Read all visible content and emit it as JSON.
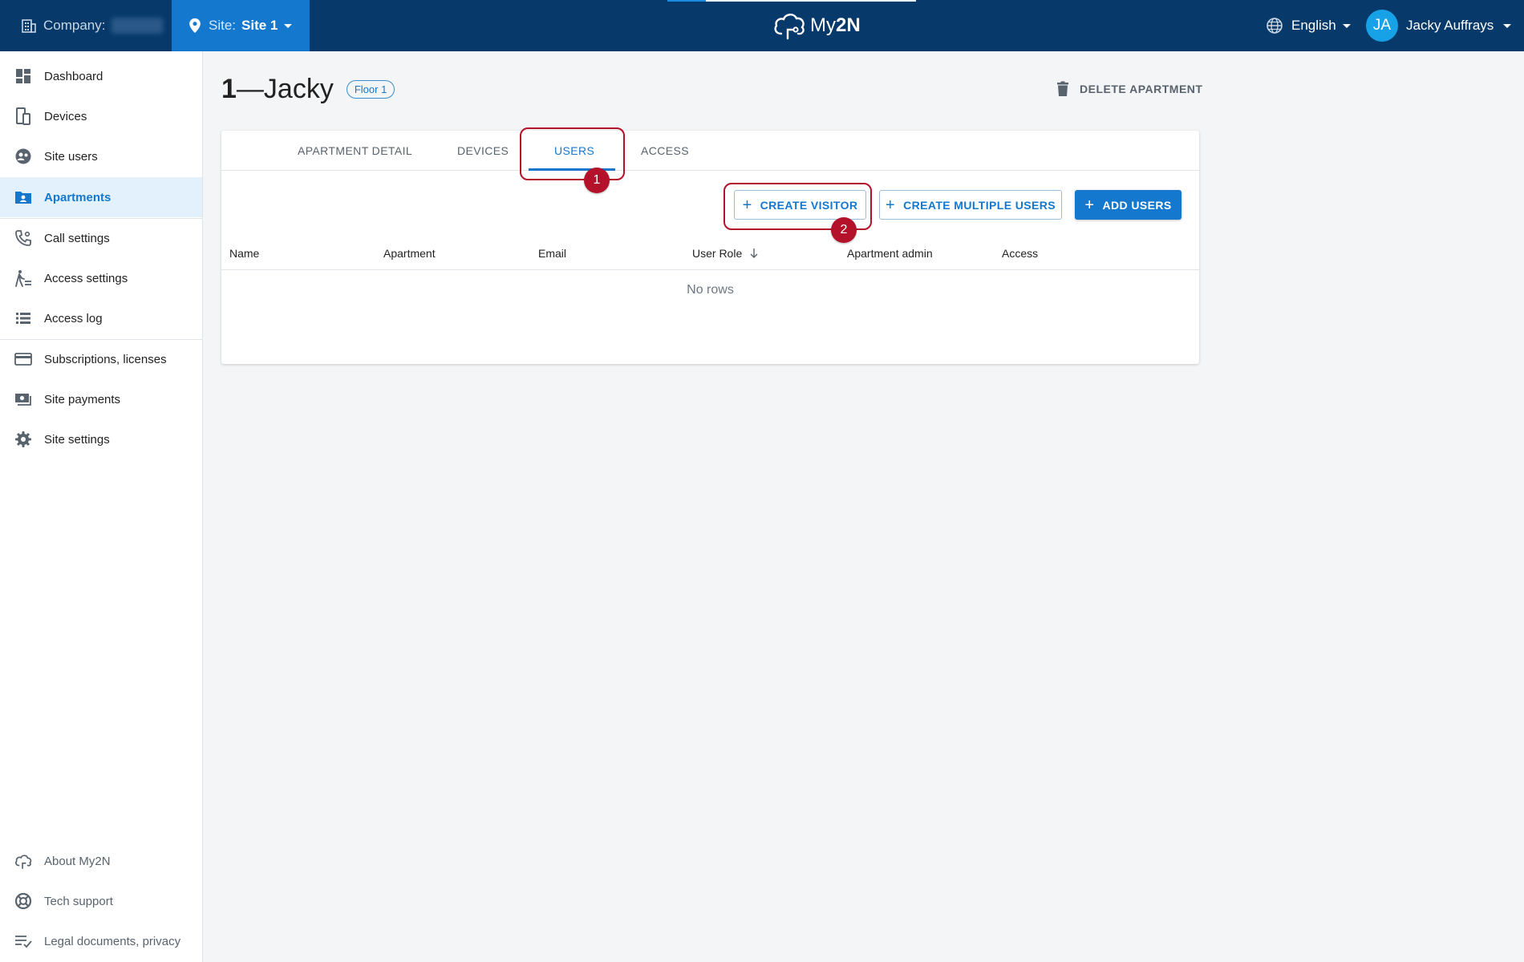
{
  "topbar": {
    "company_label": "Company:",
    "site_label": "Site:",
    "site_value": "Site 1",
    "logo_text_light": "My",
    "logo_text_bold": "2N",
    "language": "English",
    "user_initials": "JA",
    "user_name": "Jacky Auffrays"
  },
  "sidebar": {
    "items": [
      {
        "label": "Dashboard",
        "icon": "dashboard-icon"
      },
      {
        "label": "Devices",
        "icon": "devices-icon"
      },
      {
        "label": "Site users",
        "icon": "site-users-icon"
      },
      {
        "label": "Apartments",
        "icon": "apartments-icon",
        "active": true
      },
      {
        "label": "Call settings",
        "icon": "call-settings-icon"
      },
      {
        "label": "Access settings",
        "icon": "access-settings-icon"
      },
      {
        "label": "Access log",
        "icon": "access-log-icon"
      },
      {
        "label": "Subscriptions, licenses",
        "icon": "credit-card-icon"
      },
      {
        "label": "Site payments",
        "icon": "payments-icon"
      },
      {
        "label": "Site settings",
        "icon": "gear-icon"
      }
    ],
    "footer": [
      {
        "label": "About My2N",
        "icon": "cloud-icon"
      },
      {
        "label": "Tech support",
        "icon": "support-icon"
      },
      {
        "label": "Legal documents, privacy",
        "icon": "legal-icon"
      }
    ]
  },
  "apartment": {
    "number": "1",
    "separator": "—",
    "name": "Jacky",
    "floor": "Floor 1",
    "delete_label": "DELETE APARTMENT"
  },
  "tabs": [
    "APARTMENT DETAIL",
    "DEVICES",
    "USERS",
    "ACCESS"
  ],
  "active_tab": "USERS",
  "actions": {
    "create_visitor": "CREATE VISITOR",
    "create_multiple": "CREATE MULTIPLE USERS",
    "add_users": "ADD USERS"
  },
  "table": {
    "columns": [
      "Name",
      "Apartment",
      "Email",
      "User Role",
      "Apartment admin",
      "Access"
    ],
    "empty_text": "No rows"
  },
  "annotations": {
    "step1": "1",
    "step2": "2"
  },
  "colors": {
    "topbar": "#073a6b",
    "accent": "#1478cf",
    "annotation": "#b3122a"
  }
}
